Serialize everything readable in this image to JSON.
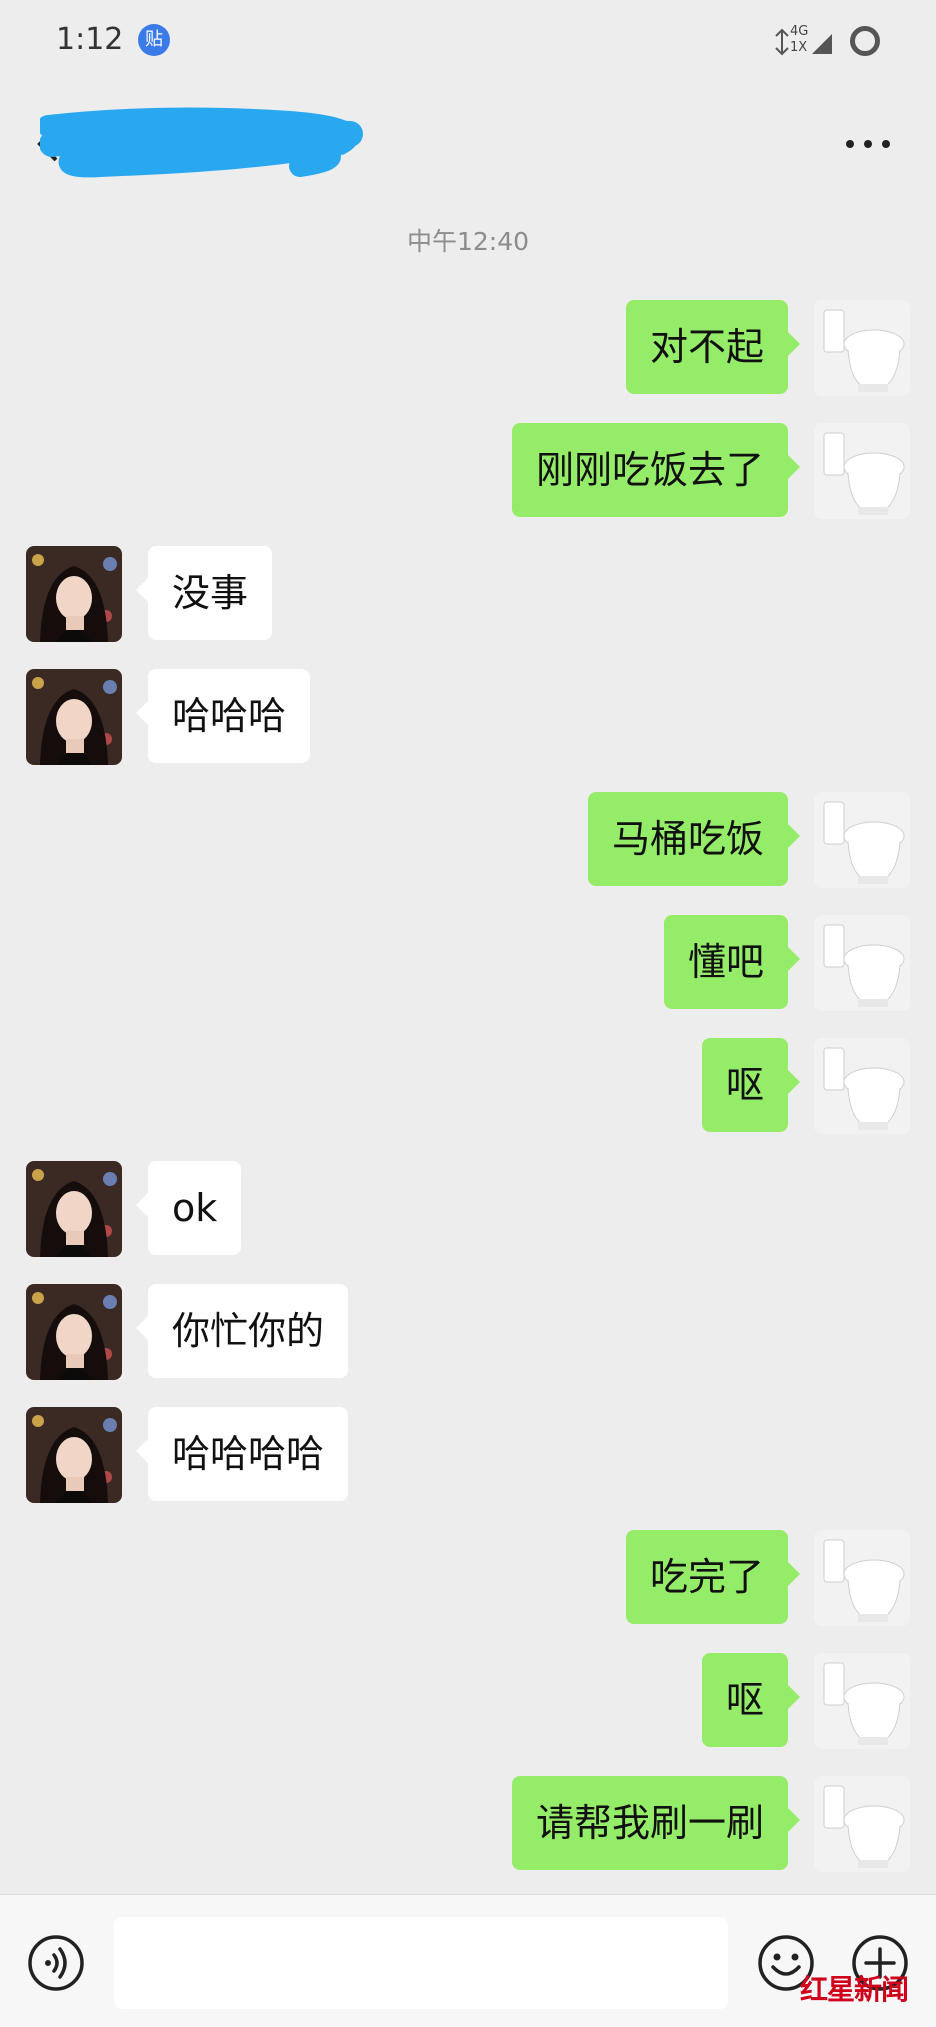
{
  "status_bar": {
    "time": "1:12",
    "app_badge": "贴",
    "network_top": "4G",
    "network_bottom": "1X"
  },
  "header": {
    "title_redacted": true,
    "more_icon": "more-dots-icon",
    "back_icon": "back-chevron-icon"
  },
  "chat": {
    "timestamp": "中午12:40",
    "messages": [
      {
        "side": "right",
        "text": "对不起"
      },
      {
        "side": "right",
        "text": "刚刚吃饭去了"
      },
      {
        "side": "left",
        "text": "没事"
      },
      {
        "side": "left",
        "text": "哈哈哈"
      },
      {
        "side": "right",
        "text": "马桶吃饭"
      },
      {
        "side": "right",
        "text": "懂吧"
      },
      {
        "side": "right",
        "text": "呕"
      },
      {
        "side": "left",
        "text": "ok"
      },
      {
        "side": "left",
        "text": "你忙你的"
      },
      {
        "side": "left",
        "text": "哈哈哈哈"
      },
      {
        "side": "right",
        "text": "吃完了"
      },
      {
        "side": "right",
        "text": "呕"
      },
      {
        "side": "right",
        "text": "请帮我刷一刷"
      }
    ]
  },
  "input_bar": {
    "value": "",
    "placeholder": "",
    "voice_icon": "voice-icon",
    "emoji_icon": "emoji-icon",
    "plus_icon": "plus-icon"
  },
  "watermark": "红星新闻",
  "colors": {
    "background": "#ededed",
    "sent_bubble": "#95ec69",
    "received_bubble": "#ffffff",
    "redaction": "#29a8f0"
  }
}
